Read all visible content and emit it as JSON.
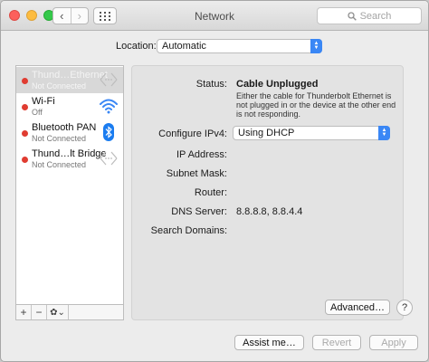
{
  "window": {
    "title": "Network"
  },
  "toolbar": {
    "back_glyph": "‹",
    "forward_glyph": "›",
    "search_placeholder": "Search"
  },
  "location": {
    "label": "Location:",
    "value": "Automatic"
  },
  "services": [
    {
      "name": "Thund…Ethernet",
      "status": "Not Connected",
      "icon": "ethernet-icon",
      "selected": true
    },
    {
      "name": "Wi-Fi",
      "status": "Off",
      "icon": "wifi-icon",
      "selected": false
    },
    {
      "name": "Bluetooth PAN",
      "status": "Not Connected",
      "icon": "bluetooth-icon",
      "selected": false
    },
    {
      "name": "Thund…lt Bridge",
      "status": "Not Connected",
      "icon": "ethernet-icon",
      "selected": false
    }
  ],
  "sidebar_controls": {
    "add": "+",
    "remove": "−",
    "gear": "✿⌄"
  },
  "details": {
    "status_label": "Status:",
    "status_value": "Cable Unplugged",
    "status_description": "Either the cable for Thunderbolt Ethernet is not plugged in or the device at the other end is not responding.",
    "configure_label": "Configure IPv4:",
    "configure_value": "Using DHCP",
    "ip_label": "IP Address:",
    "subnet_label": "Subnet Mask:",
    "router_label": "Router:",
    "dns_label": "DNS Server:",
    "dns_value": "8.8.8.8, 8.8.4.4",
    "search_domains_label": "Search Domains:"
  },
  "buttons": {
    "advanced": "Advanced…",
    "help": "?",
    "assist": "Assist me…",
    "revert": "Revert",
    "apply": "Apply"
  },
  "colors": {
    "status_dot": "#e03c31",
    "accent": "#3a87f5",
    "bluetooth": "#1a7cf0"
  }
}
